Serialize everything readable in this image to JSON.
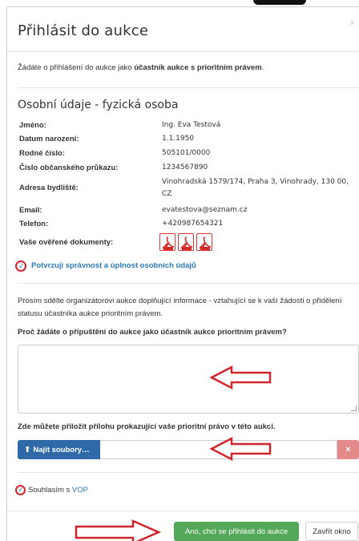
{
  "dialog": {
    "title": "Přihlásit do aukce",
    "close_glyph": "×"
  },
  "intro": {
    "prefix": "Žádáte o přihlášení do aukce jako ",
    "role": "účastník aukce s prioritním právem",
    "suffix": "."
  },
  "personal": {
    "section_title": "Osobní údaje - fyzická osoba",
    "fields": [
      {
        "label": "Jméno:",
        "value": "Ing. Eva Testová"
      },
      {
        "label": "Datum narození:",
        "value": "1.1.1950"
      },
      {
        "label": "Rodné číslo:",
        "value": "505101/0000"
      },
      {
        "label": "Číslo občanského průkazu:",
        "value": "1234567890"
      },
      {
        "label": "Adresa bydliště:",
        "value": "Vinohradská 1579/174, Praha 3, Vinohrady, 130 00, CZ"
      },
      {
        "label": "Email:",
        "value": "evatestova@seznam.cz"
      },
      {
        "label": "Telefon:",
        "value": "+420987654321"
      }
    ],
    "documents_label": "Vaše ověřené dokumenty:",
    "documents": [
      "pdf-document-icon",
      "pdf-document-icon",
      "pdf-document-icon"
    ],
    "confirm_label": "Potvrzuji správnost a úplnost osobních údajů"
  },
  "request": {
    "info": "Prosím sdělte organizátorovi aukce doplňující informace - vztahující se k vaší žádosti o přidělení statusu účastníka aukce prioritním právem.",
    "question": "Proč žádáte o připuštění do aukce jako účastník aukce prioritním právem?",
    "reason_value": "",
    "attach_label": "Zde můžete přiložit přílohu prokazující vaše prioritní právo v této aukci.",
    "upload_label": "Najít soubory…",
    "upload_value": "",
    "remove_glyph": "×"
  },
  "terms": {
    "prefix": "Souhlasím s ",
    "link": "VOP"
  },
  "footer": {
    "primary_label": "Ano, chci se přihlásit do aukce",
    "secondary_label": "Zavřít okno"
  },
  "colors": {
    "primary_green": "#54a85a",
    "upload_blue": "#2e6aa8",
    "remove_red": "#e58a8a",
    "link_blue": "#2a7ab8",
    "annotation_red": "#d0262b"
  }
}
